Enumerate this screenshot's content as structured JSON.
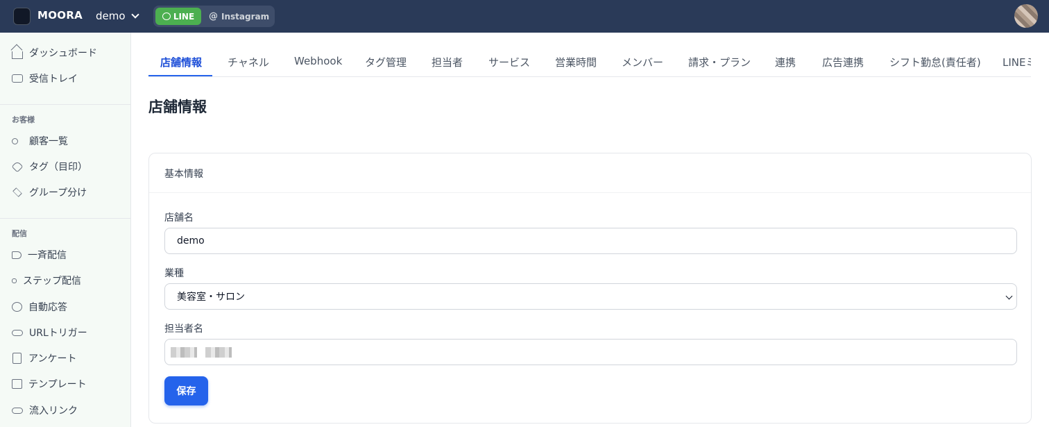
{
  "topbar": {
    "brand": "MOORA",
    "shop_name": "demo",
    "channels": {
      "line": "LINE",
      "instagram": "Instagram"
    }
  },
  "sidebar": {
    "top_items": [
      {
        "label": "ダッシュボード",
        "icon": "home-icon"
      },
      {
        "label": "受信トレイ",
        "icon": "inbox-icon"
      }
    ],
    "sections": [
      {
        "title": "お客様",
        "items": [
          {
            "label": "顧客一覧",
            "icon": "users-icon"
          },
          {
            "label": "タグ（目印）",
            "icon": "tag-icon"
          },
          {
            "label": "グループ分け",
            "icon": "stack-icon"
          }
        ]
      },
      {
        "title": "配信",
        "items": [
          {
            "label": "一斉配信",
            "icon": "megaphone-icon"
          },
          {
            "label": "ステップ配信",
            "icon": "step-icon"
          },
          {
            "label": "自動応答",
            "icon": "chat-icon"
          },
          {
            "label": "URLトリガー",
            "icon": "link-icon"
          },
          {
            "label": "アンケート",
            "icon": "clipboard-icon"
          },
          {
            "label": "テンプレート",
            "icon": "template-icon"
          },
          {
            "label": "流入リンク",
            "icon": "link-icon"
          }
        ]
      }
    ]
  },
  "tabs": [
    "店舗情報",
    "チャネル",
    "Webhook",
    "タグ管理",
    "担当者",
    "サービス",
    "営業時間",
    "メンバー",
    "請求・プラン",
    "連携",
    "広告連携",
    "シフト勤怠(責任者)",
    "LINEミ"
  ],
  "page_title": "店舗情報",
  "card": {
    "title": "基本情報",
    "fields": {
      "store_name": {
        "label": "店舗名",
        "value": "demo"
      },
      "industry": {
        "label": "業種",
        "value": "美容室・サロン"
      },
      "manager_name": {
        "label": "担当者名",
        "value": ""
      }
    },
    "save_label": "保存"
  },
  "colors": {
    "topbar": "#2a3a58",
    "accent": "#2563eb",
    "line_green": "#4caf50",
    "sidebar_bg": "#f5faf6"
  }
}
